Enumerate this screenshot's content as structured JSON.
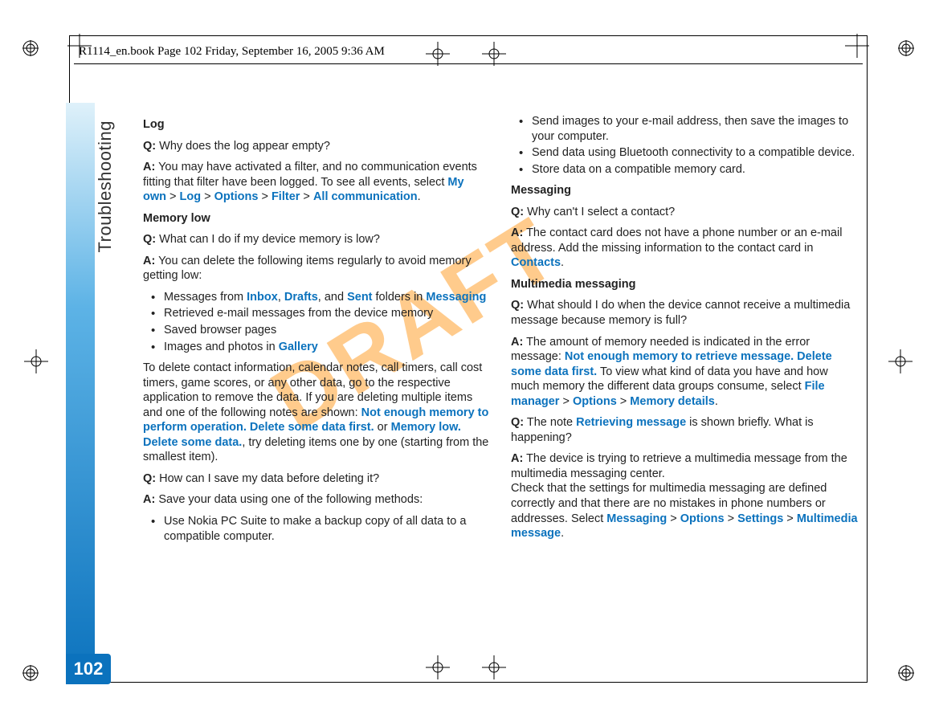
{
  "header": {
    "text": "R1114_en.book  Page 102  Friday, September 16, 2005  9:36 AM"
  },
  "watermark": "DRAFT",
  "page_number": "102",
  "side_label": "Troubleshooting",
  "left_column": {
    "h_log": "Log",
    "q_log": {
      "q_prefix": "Q:",
      "q_text": " Why does the log appear empty?"
    },
    "a_log": {
      "a_prefix": "A:",
      "pre": " You may have activated a filter, and no communication events fitting that filter have been logged. To see all events, select ",
      "ui1": "My own",
      "gt1": " > ",
      "ui2": "Log",
      "gt2": " > ",
      "ui3": "Options",
      "gt3": " > ",
      "ui4": "Filter",
      "gt4": " > ",
      "ui5": "All communication",
      "post": "."
    },
    "h_mem": "Memory low",
    "q_mem": {
      "q_prefix": "Q:",
      "q_text": " What can I do if my device memory is low?"
    },
    "a_mem": {
      "a_prefix": "A:",
      "a_text": " You can delete the following items regularly to avoid memory getting low:"
    },
    "mem_bullets": {
      "b1_pre": "Messages from ",
      "b1_u1": "Inbox",
      "b1_c1": ", ",
      "b1_u2": "Drafts",
      "b1_c2": ", and ",
      "b1_u3": "Sent",
      "b1_mid": " folders in ",
      "b1_u4": "Messaging",
      "b2": "Retrieved e-mail messages from the device memory",
      "b3": "Saved browser pages",
      "b4_pre": "Images and photos in ",
      "b4_u1": "Gallery"
    },
    "para_delete": {
      "pre": "To delete contact information, calendar notes, call timers, call cost timers, game scores, or any other data, go to the respective application to remove the data. If you are deleting multiple items and one of the following notes are shown: ",
      "ui1": "Not enough memory to perform operation. Delete some data first.",
      "mid1": " or ",
      "ui2": "Memory low. Delete some data.",
      "post": ", try deleting items one by one (starting from the smallest item)."
    },
    "q_save": {
      "q_prefix": "Q:",
      "q_text": " How can I save my data before deleting it?"
    },
    "a_save": {
      "a_prefix": "A:",
      "a_text": " Save your data using one of the following methods:"
    },
    "save_b1": "Use Nokia PC Suite to make a backup copy of all data to a compatible computer."
  },
  "right_column": {
    "save_b2": "Send images to your e-mail address, then save the images to your computer.",
    "save_b3": "Send data using Bluetooth connectivity to a compatible device.",
    "save_b4": "Store data on a compatible memory card.",
    "h_msg": "Messaging",
    "q_contact": {
      "q_prefix": "Q:",
      "q_text": " Why can't I select a contact?"
    },
    "a_contact": {
      "a_prefix": "A:",
      "pre": " The contact card does not have a phone number or an e-mail address. Add the missing information to the contact card in ",
      "ui1": "Contacts",
      "post": "."
    },
    "h_mms": "Multimedia messaging",
    "q_mms1": {
      "q_prefix": "Q:",
      "q_text": " What should I do when the device cannot receive a multimedia message because memory is full?"
    },
    "a_mms1": {
      "a_prefix": "A:",
      "pre": " The amount of memory needed is indicated in the error message: ",
      "ui1": "Not enough memory to retrieve message. Delete some data first.",
      "mid": " To view what kind of data you have and how much memory the different data groups consume, select ",
      "ui2": "File manager",
      "gt1": " > ",
      "ui3": "Options",
      "gt2": " > ",
      "ui4": "Memory details",
      "post": "."
    },
    "q_mms2": {
      "q_prefix": "Q:",
      "pre": " The note ",
      "ui1": "Retrieving message",
      "post": " is shown briefly. What is happening?"
    },
    "a_mms2": {
      "a_prefix": "A:",
      "line1": " The device is trying to retrieve a multimedia message from the multimedia messaging center.",
      "line2_pre": "Check that the settings for multimedia messaging are defined correctly and that there are no mistakes in phone numbers or addresses. Select ",
      "ui1": "Messaging",
      "gt1": " > ",
      "ui2": "Options",
      "gt2": " > ",
      "ui3": "Settings",
      "gt3": " > ",
      "ui4": "Multimedia message",
      "post": "."
    }
  }
}
